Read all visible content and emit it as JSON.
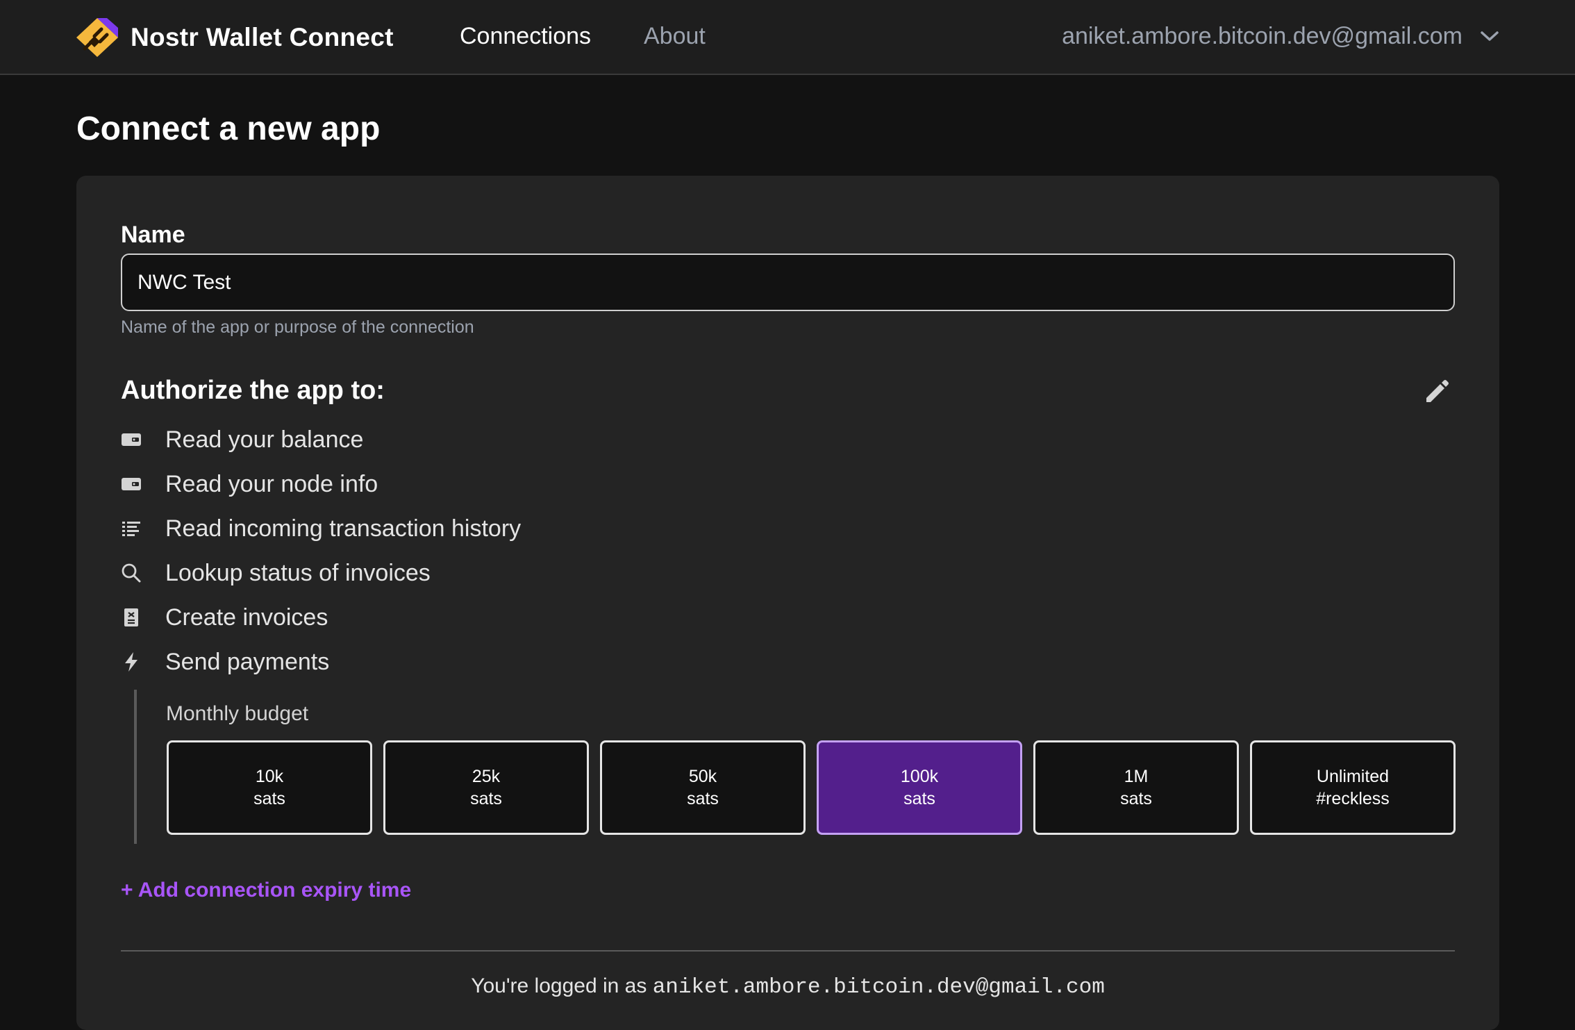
{
  "header": {
    "brand_name": "Nostr Wallet Connect",
    "nav": {
      "connections": "Connections",
      "about": "About"
    },
    "user_email": "aniket.ambore.bitcoin.dev@gmail.com",
    "user_menu_icon": "chevron-down-icon"
  },
  "page": {
    "title": "Connect a new app"
  },
  "form": {
    "name_label": "Name",
    "name_value": "NWC Test",
    "name_help": "Name of the app or purpose of the connection",
    "authorize_title": "Authorize the app to:",
    "edit_icon": "pencil-icon",
    "permissions": [
      {
        "icon": "wallet-icon",
        "label": "Read your balance"
      },
      {
        "icon": "wallet-icon",
        "label": "Read your node info"
      },
      {
        "icon": "list-icon",
        "label": "Read incoming transaction history"
      },
      {
        "icon": "search-icon",
        "label": "Lookup status of invoices"
      },
      {
        "icon": "receipt-icon",
        "label": "Create invoices"
      },
      {
        "icon": "lightning-icon",
        "label": "Send payments"
      }
    ],
    "budget": {
      "label": "Monthly budget",
      "selected_index": 3,
      "options": [
        {
          "line1": "10k",
          "line2": "sats"
        },
        {
          "line1": "25k",
          "line2": "sats"
        },
        {
          "line1": "50k",
          "line2": "sats"
        },
        {
          "line1": "100k",
          "line2": "sats"
        },
        {
          "line1": "1M",
          "line2": "sats"
        },
        {
          "line1": "Unlimited",
          "line2": "#reckless"
        }
      ]
    },
    "expiry_link": "+ Add connection expiry time",
    "logged_in_prefix": "You're logged in as",
    "logged_in_email": "aniket.ambore.bitcoin.dev@gmail.com"
  },
  "colors": {
    "accent": "#a855f7",
    "selected_bg": "#531f8c",
    "selected_border": "#c4a1f4",
    "card_bg": "#242424",
    "page_bg": "#121212"
  }
}
